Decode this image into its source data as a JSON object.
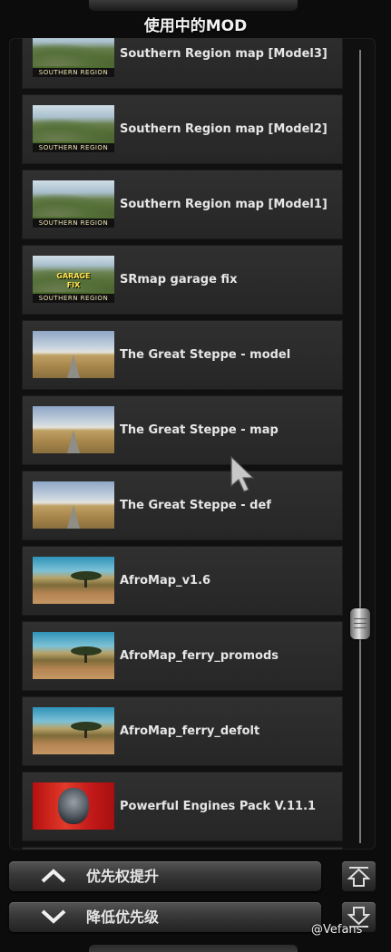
{
  "panel": {
    "title": "使用中的MOD"
  },
  "mods": [
    {
      "label": "Southern Region map [Model3]",
      "thumb_icon": "southern-region-thumbnail",
      "thumb_tag": "SOUTHERN REGION"
    },
    {
      "label": "Southern Region map [Model2]",
      "thumb_icon": "southern-region-thumbnail",
      "thumb_tag": "SOUTHERN REGION"
    },
    {
      "label": "Southern Region map [Model1]",
      "thumb_icon": "southern-region-thumbnail",
      "thumb_tag": "SOUTHERN REGION"
    },
    {
      "label": "SRmap garage fix",
      "thumb_icon": "garage-fix-thumbnail",
      "thumb_tag": "SOUTHERN REGION",
      "thumb_text_1": "GARAGE",
      "thumb_text_2": "FIX"
    },
    {
      "label": "The Great Steppe - model",
      "thumb_icon": "steppe-road-thumbnail"
    },
    {
      "label": "The Great Steppe - map",
      "thumb_icon": "steppe-road-thumbnail"
    },
    {
      "label": "The Great Steppe - def",
      "thumb_icon": "steppe-road-thumbnail"
    },
    {
      "label": "AfroMap_v1.6",
      "thumb_icon": "africa-tree-thumbnail"
    },
    {
      "label": "AfroMap_ferry_promods",
      "thumb_icon": "africa-tree-thumbnail"
    },
    {
      "label": "AfroMap_ferry_defolt",
      "thumb_icon": "africa-tree-thumbnail"
    },
    {
      "label": "Powerful Engines Pack  V.11.1",
      "thumb_icon": "engine-skull-thumbnail"
    }
  ],
  "buttons": {
    "priority_up": "优先权提升",
    "priority_down": "降低优先级"
  },
  "scrollbar": {
    "position_fraction": 0.7
  },
  "watermark": "@Vefans"
}
